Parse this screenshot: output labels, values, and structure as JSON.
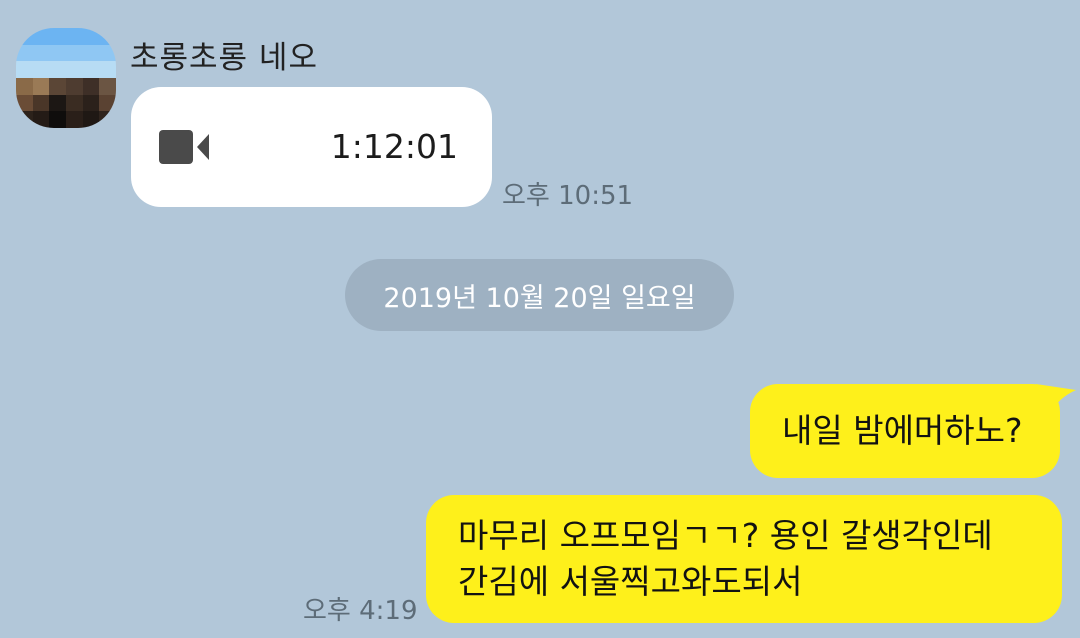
{
  "chat": {
    "sender_name": "초롱초롱 네오",
    "video_message": {
      "icon": "video-camera-icon",
      "duration": "1:12:01",
      "time": "오후 10:51"
    },
    "date_divider": "2019년 10월 20일 일요일",
    "outgoing_messages": [
      {
        "text": "내일 밤에머하노?"
      },
      {
        "lines": [
          "마무리 오프모임ㄱㄱ? 용인 갈생각인데",
          "간김에 서울찍고와도되서"
        ],
        "time": "오후 4:19"
      }
    ]
  },
  "colors": {
    "background": "#b2c7d9",
    "outgoing_bubble": "#fef01b",
    "incoming_bubble": "#ffffff",
    "date_pill": "#9eb1c2",
    "timestamp": "#5d6c78"
  }
}
